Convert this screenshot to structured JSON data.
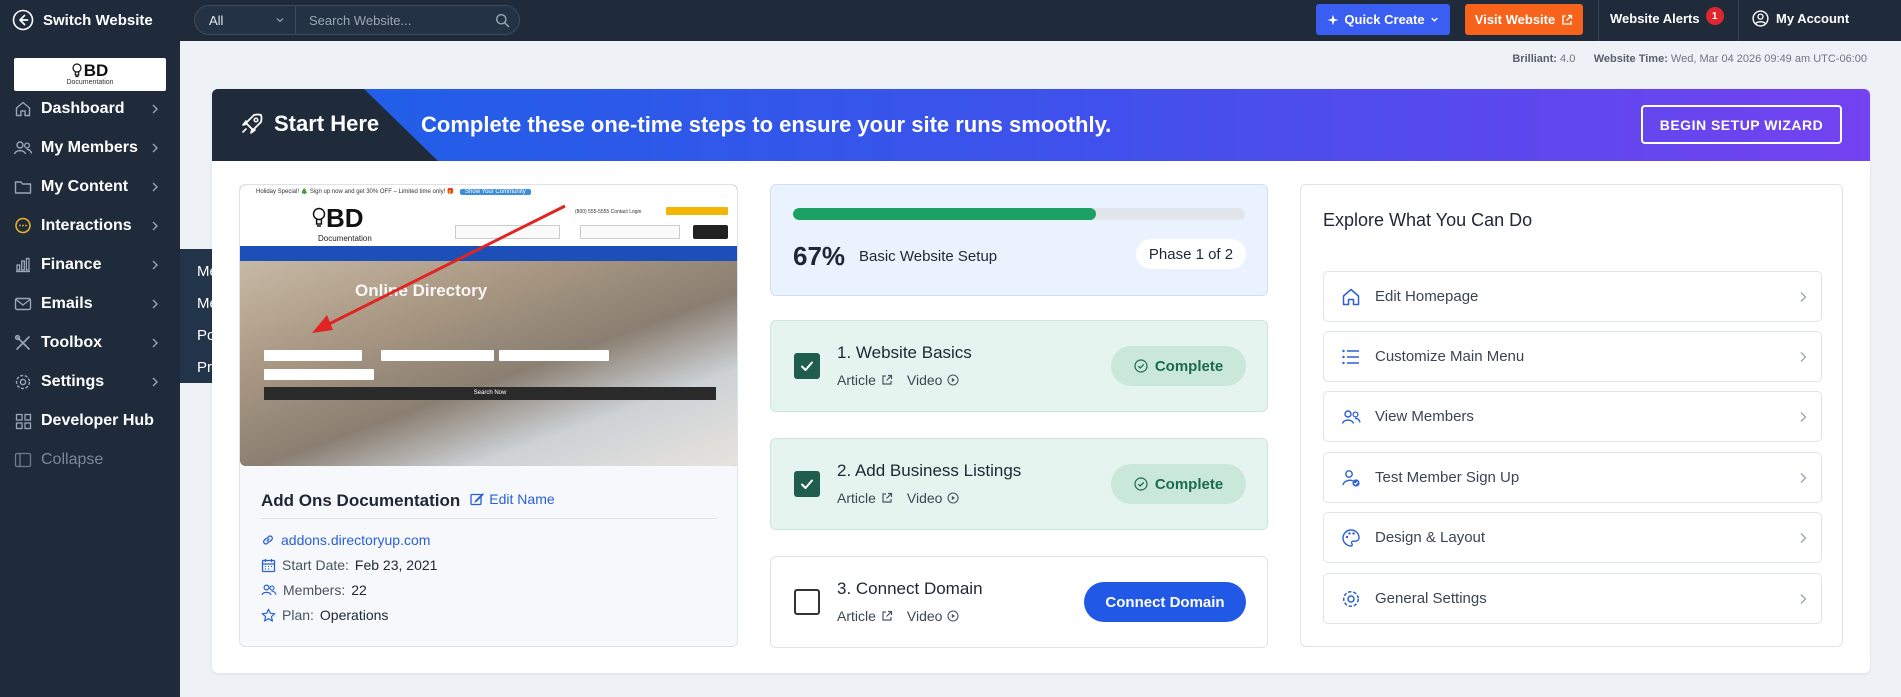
{
  "topbar": {
    "switch_label": "Switch Website",
    "search_scope": "All",
    "search_placeholder": "Search Website...",
    "quick_create": "Quick Create",
    "visit_website": "Visit Website",
    "alerts_label": "Website Alerts",
    "alerts_count": "1",
    "account_label": "My Account"
  },
  "sidebar": {
    "logo_text": "BD",
    "logo_sub": "Documentation",
    "items": [
      {
        "label": "Dashboard"
      },
      {
        "label": "My Members"
      },
      {
        "label": "My Content"
      },
      {
        "label": "Interactions"
      },
      {
        "label": "Finance"
      },
      {
        "label": "Emails"
      },
      {
        "label": "Toolbox"
      },
      {
        "label": "Settings"
      },
      {
        "label": "Developer Hub"
      },
      {
        "label": "Collapse"
      }
    ],
    "submenu": [
      {
        "label": "Member Leads"
      },
      {
        "label": "Member Reviews"
      },
      {
        "label": "Post Comments"
      },
      {
        "label": "Private Chats"
      }
    ]
  },
  "meta": {
    "plan_label": "Brilliant:",
    "plan_version": "4.0",
    "time_label": "Website Time:",
    "time_value": "Wed, Mar 04 2026 09:49 am UTC-06:00"
  },
  "banner": {
    "start_here": "Start Here",
    "message": "Complete these one-time steps to ensure your site runs smoothly.",
    "wizard_button": "BEGIN SETUP WIZARD"
  },
  "site": {
    "thumb": {
      "promo": "Holiday Special! 🎄 Sign up now and get 30% OFF – Limited time only! 🎁",
      "promo_button": "Show Your Community",
      "logo": "BD",
      "logo_sub": "Documentation",
      "links": "(800) 555-5555    Contact    Login",
      "hero_title": "Online Directory",
      "search_button": "Search Now"
    },
    "name": "Add Ons Documentation",
    "edit_name": "Edit Name",
    "url": "addons.directoryup.com",
    "start_date_label": "Start Date:",
    "start_date": "Feb 23, 2021",
    "members_label": "Members:",
    "members": "22",
    "plan_label": "Plan:",
    "plan": "Operations"
  },
  "progress": {
    "percent_text": "67%",
    "percent_value": 0.67,
    "label": "Basic Website Setup",
    "phase": "Phase 1 of 2"
  },
  "steps": [
    {
      "title": "1. Website Basics",
      "article": "Article",
      "video": "Video",
      "status": "Complete"
    },
    {
      "title": "2. Add Business Listings",
      "article": "Article",
      "video": "Video",
      "status": "Complete"
    },
    {
      "title": "3. Connect Domain",
      "article": "Article",
      "video": "Video",
      "action": "Connect Domain"
    }
  ],
  "explore": {
    "title": "Explore What You Can Do",
    "items": [
      {
        "label": "Edit Homepage",
        "icon": "home-icon"
      },
      {
        "label": "Customize Main Menu",
        "icon": "list-icon"
      },
      {
        "label": "View Members",
        "icon": "users-icon"
      },
      {
        "label": "Test Member Sign Up",
        "icon": "user-check-icon"
      },
      {
        "label": "Design & Layout",
        "icon": "palette-icon"
      },
      {
        "label": "General Settings",
        "icon": "gear-icon"
      }
    ]
  },
  "colors": {
    "nav_bg": "#1f2b3b",
    "quick_create": "#3a5ef2",
    "visit_website": "#f7631b",
    "progress_fill": "#1aa163",
    "primary_button": "#2158e6"
  }
}
